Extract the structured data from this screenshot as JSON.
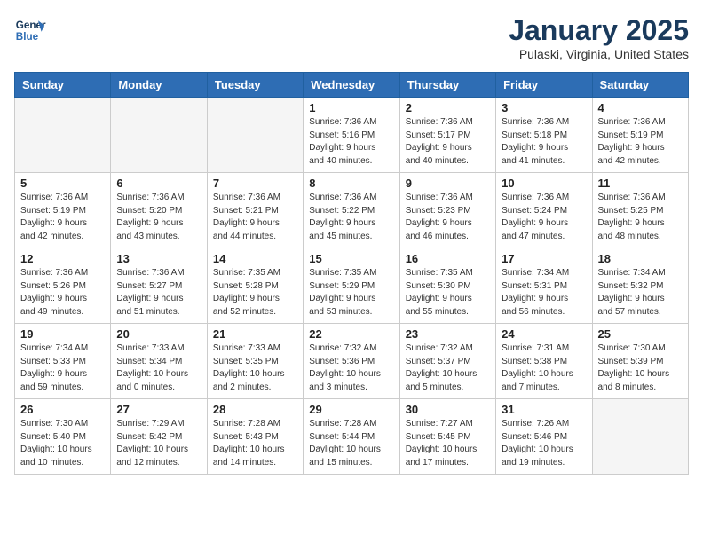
{
  "logo": {
    "line1": "General",
    "line2": "Blue"
  },
  "title": "January 2025",
  "location": "Pulaski, Virginia, United States",
  "days_of_week": [
    "Sunday",
    "Monday",
    "Tuesday",
    "Wednesday",
    "Thursday",
    "Friday",
    "Saturday"
  ],
  "weeks": [
    [
      {
        "day": "",
        "info": ""
      },
      {
        "day": "",
        "info": ""
      },
      {
        "day": "",
        "info": ""
      },
      {
        "day": "1",
        "info": "Sunrise: 7:36 AM\nSunset: 5:16 PM\nDaylight: 9 hours\nand 40 minutes."
      },
      {
        "day": "2",
        "info": "Sunrise: 7:36 AM\nSunset: 5:17 PM\nDaylight: 9 hours\nand 40 minutes."
      },
      {
        "day": "3",
        "info": "Sunrise: 7:36 AM\nSunset: 5:18 PM\nDaylight: 9 hours\nand 41 minutes."
      },
      {
        "day": "4",
        "info": "Sunrise: 7:36 AM\nSunset: 5:19 PM\nDaylight: 9 hours\nand 42 minutes."
      }
    ],
    [
      {
        "day": "5",
        "info": "Sunrise: 7:36 AM\nSunset: 5:19 PM\nDaylight: 9 hours\nand 42 minutes."
      },
      {
        "day": "6",
        "info": "Sunrise: 7:36 AM\nSunset: 5:20 PM\nDaylight: 9 hours\nand 43 minutes."
      },
      {
        "day": "7",
        "info": "Sunrise: 7:36 AM\nSunset: 5:21 PM\nDaylight: 9 hours\nand 44 minutes."
      },
      {
        "day": "8",
        "info": "Sunrise: 7:36 AM\nSunset: 5:22 PM\nDaylight: 9 hours\nand 45 minutes."
      },
      {
        "day": "9",
        "info": "Sunrise: 7:36 AM\nSunset: 5:23 PM\nDaylight: 9 hours\nand 46 minutes."
      },
      {
        "day": "10",
        "info": "Sunrise: 7:36 AM\nSunset: 5:24 PM\nDaylight: 9 hours\nand 47 minutes."
      },
      {
        "day": "11",
        "info": "Sunrise: 7:36 AM\nSunset: 5:25 PM\nDaylight: 9 hours\nand 48 minutes."
      }
    ],
    [
      {
        "day": "12",
        "info": "Sunrise: 7:36 AM\nSunset: 5:26 PM\nDaylight: 9 hours\nand 49 minutes."
      },
      {
        "day": "13",
        "info": "Sunrise: 7:36 AM\nSunset: 5:27 PM\nDaylight: 9 hours\nand 51 minutes."
      },
      {
        "day": "14",
        "info": "Sunrise: 7:35 AM\nSunset: 5:28 PM\nDaylight: 9 hours\nand 52 minutes."
      },
      {
        "day": "15",
        "info": "Sunrise: 7:35 AM\nSunset: 5:29 PM\nDaylight: 9 hours\nand 53 minutes."
      },
      {
        "day": "16",
        "info": "Sunrise: 7:35 AM\nSunset: 5:30 PM\nDaylight: 9 hours\nand 55 minutes."
      },
      {
        "day": "17",
        "info": "Sunrise: 7:34 AM\nSunset: 5:31 PM\nDaylight: 9 hours\nand 56 minutes."
      },
      {
        "day": "18",
        "info": "Sunrise: 7:34 AM\nSunset: 5:32 PM\nDaylight: 9 hours\nand 57 minutes."
      }
    ],
    [
      {
        "day": "19",
        "info": "Sunrise: 7:34 AM\nSunset: 5:33 PM\nDaylight: 9 hours\nand 59 minutes."
      },
      {
        "day": "20",
        "info": "Sunrise: 7:33 AM\nSunset: 5:34 PM\nDaylight: 10 hours\nand 0 minutes."
      },
      {
        "day": "21",
        "info": "Sunrise: 7:33 AM\nSunset: 5:35 PM\nDaylight: 10 hours\nand 2 minutes."
      },
      {
        "day": "22",
        "info": "Sunrise: 7:32 AM\nSunset: 5:36 PM\nDaylight: 10 hours\nand 3 minutes."
      },
      {
        "day": "23",
        "info": "Sunrise: 7:32 AM\nSunset: 5:37 PM\nDaylight: 10 hours\nand 5 minutes."
      },
      {
        "day": "24",
        "info": "Sunrise: 7:31 AM\nSunset: 5:38 PM\nDaylight: 10 hours\nand 7 minutes."
      },
      {
        "day": "25",
        "info": "Sunrise: 7:30 AM\nSunset: 5:39 PM\nDaylight: 10 hours\nand 8 minutes."
      }
    ],
    [
      {
        "day": "26",
        "info": "Sunrise: 7:30 AM\nSunset: 5:40 PM\nDaylight: 10 hours\nand 10 minutes."
      },
      {
        "day": "27",
        "info": "Sunrise: 7:29 AM\nSunset: 5:42 PM\nDaylight: 10 hours\nand 12 minutes."
      },
      {
        "day": "28",
        "info": "Sunrise: 7:28 AM\nSunset: 5:43 PM\nDaylight: 10 hours\nand 14 minutes."
      },
      {
        "day": "29",
        "info": "Sunrise: 7:28 AM\nSunset: 5:44 PM\nDaylight: 10 hours\nand 15 minutes."
      },
      {
        "day": "30",
        "info": "Sunrise: 7:27 AM\nSunset: 5:45 PM\nDaylight: 10 hours\nand 17 minutes."
      },
      {
        "day": "31",
        "info": "Sunrise: 7:26 AM\nSunset: 5:46 PM\nDaylight: 10 hours\nand 19 minutes."
      },
      {
        "day": "",
        "info": ""
      }
    ]
  ]
}
